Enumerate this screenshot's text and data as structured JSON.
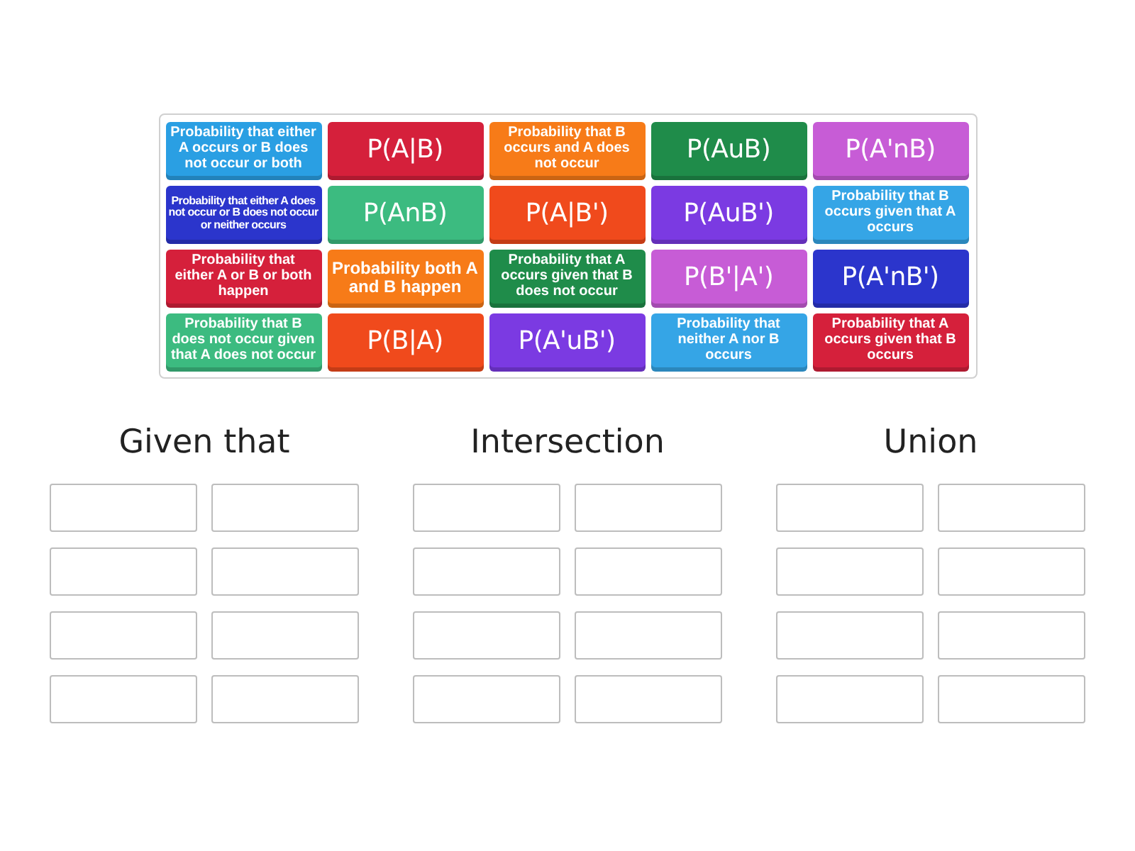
{
  "tiles": [
    {
      "kind": "description",
      "text": "Probability that either A occurs or B does not occur or both",
      "color": "#2a9fe3"
    },
    {
      "kind": "notation",
      "text": "P(A|B)",
      "color": "#d5203b"
    },
    {
      "kind": "description",
      "text": "Probability that B occurs and A does not occur",
      "color": "#f77b18"
    },
    {
      "kind": "notation",
      "text": "P(AuB)",
      "color": "#1f8c4a"
    },
    {
      "kind": "notation",
      "text": "P(A'nB)",
      "color": "#c75cd6"
    },
    {
      "kind": "description",
      "text": "Probability that either A does not occur or B does not occur or neither occurs",
      "color": "#2b35cc"
    },
    {
      "kind": "notation",
      "text": "P(AnB)",
      "color": "#3cbb80"
    },
    {
      "kind": "notation",
      "text": "P(A|B')",
      "color": "#f04a1c"
    },
    {
      "kind": "notation",
      "text": "P(AuB')",
      "color": "#7b3ae2"
    },
    {
      "kind": "description",
      "text": "Probability that B occurs given that A occurs",
      "color": "#35a5e6"
    },
    {
      "kind": "description",
      "text": "Probability that either A or B or both happen",
      "color": "#d5203b"
    },
    {
      "kind": "description",
      "text": "Probability both A and B happen",
      "color": "#f77b18"
    },
    {
      "kind": "description",
      "text": "Probability that A occurs given that B does not occur",
      "color": "#1f8c4a"
    },
    {
      "kind": "notation",
      "text": "P(B'|A')",
      "color": "#c75cd6"
    },
    {
      "kind": "notation",
      "text": "P(A'nB')",
      "color": "#2b35cc"
    },
    {
      "kind": "description",
      "text": "Probability that B does not occur given that A does not occur",
      "color": "#3cbb80"
    },
    {
      "kind": "notation",
      "text": "P(B|A)",
      "color": "#f04a1c"
    },
    {
      "kind": "notation",
      "text": "P(A'uB')",
      "color": "#7b3ae2"
    },
    {
      "kind": "description",
      "text": "Probability that neither A nor B occurs",
      "color": "#35a5e6"
    },
    {
      "kind": "description",
      "text": "Probability that A occurs given that B occurs",
      "color": "#d5203b"
    }
  ],
  "groups": [
    {
      "title": "Given that",
      "boxes": [
        {
          "filled": false
        },
        {
          "filled": false
        },
        {
          "filled": false
        },
        {
          "filled": false
        },
        {
          "filled": false
        },
        {
          "filled": false
        },
        {
          "filled": false
        },
        {
          "filled": false
        }
      ]
    },
    {
      "title": "Intersection",
      "boxes": [
        {
          "filled": false
        },
        {
          "filled": false
        },
        {
          "filled": false
        },
        {
          "filled": false
        },
        {
          "filled": false
        },
        {
          "filled": false
        },
        {
          "filled": false
        },
        {
          "filled": false
        }
      ]
    },
    {
      "title": "Union",
      "boxes": [
        {
          "filled": false
        },
        {
          "filled": false
        },
        {
          "filled": false
        },
        {
          "filled": false
        },
        {
          "filled": false
        },
        {
          "filled": false
        },
        {
          "filled": false
        },
        {
          "filled": false
        }
      ]
    }
  ]
}
